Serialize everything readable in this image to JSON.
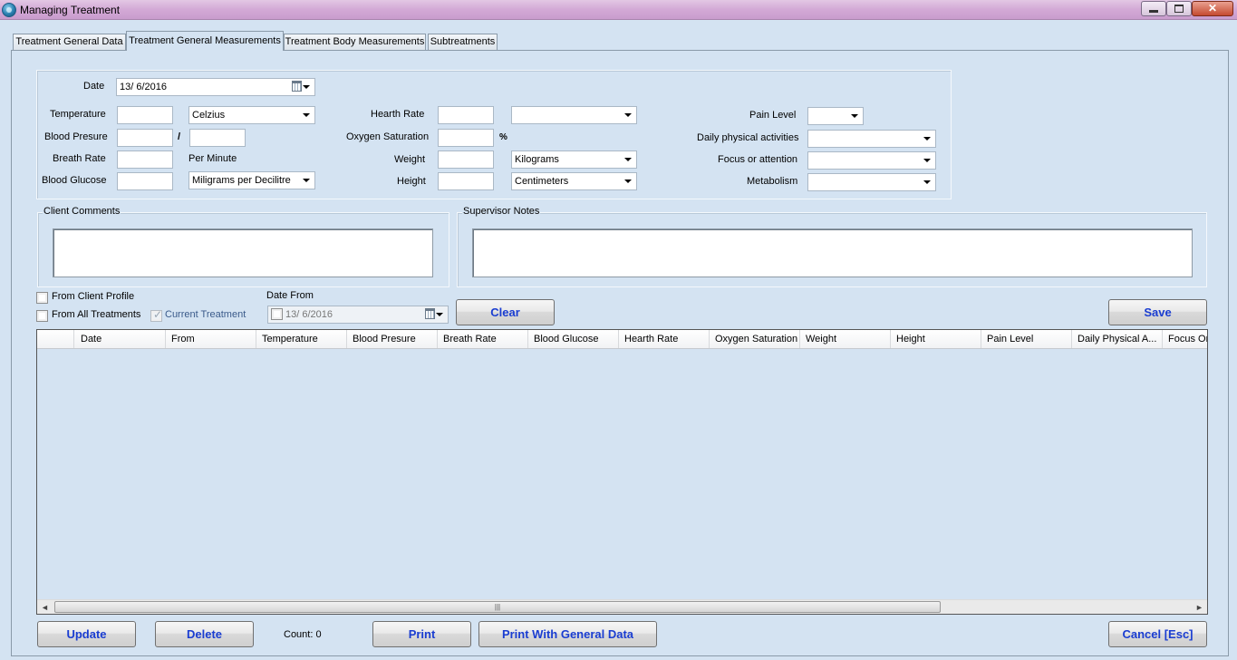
{
  "window": {
    "title": "Managing Treatment",
    "minimize": "",
    "maximize": "",
    "close": "✕"
  },
  "tabs": [
    {
      "label": "Treatment General Data"
    },
    {
      "label": "Treatment General Measurements"
    },
    {
      "label": "Treatment Body Measurements"
    },
    {
      "label": "Subtreatments"
    }
  ],
  "form": {
    "date_label": "Date",
    "date_value": "13/  6/2016",
    "temperature_label": "Temperature",
    "temperature_value": "",
    "temperature_unit": "Celzius",
    "blood_pressure_label": "Blood Presure",
    "blood_pressure_separator": "/",
    "blood_pressure_sys": "",
    "blood_pressure_dia": "",
    "breath_rate_label": "Breath Rate",
    "breath_rate_value": "",
    "breath_rate_unit": "Per Minute",
    "blood_glucose_label": "Blood Glucose",
    "blood_glucose_value": "",
    "blood_glucose_unit": "Miligrams per Decilitre",
    "hearth_rate_label": "Hearth Rate",
    "hearth_rate_value": "",
    "hearth_rate_unit": "",
    "oxygen_label": "Oxygen Saturation",
    "oxygen_value": "",
    "oxygen_unit": "%",
    "weight_label": "Weight",
    "weight_value": "",
    "weight_unit": "Kilograms",
    "height_label": "Height",
    "height_value": "",
    "height_unit": "Centimeters",
    "pain_label": "Pain Level",
    "pain_value": "",
    "daily_label": "Daily physical activities",
    "daily_value": "",
    "focus_label": "Focus or attention",
    "focus_value": "",
    "metabolism_label": "Metabolism",
    "metabolism_value": ""
  },
  "comments": {
    "client_label": "Client Comments",
    "client_value": "",
    "supervisor_label": "Supervisor Notes",
    "supervisor_value": ""
  },
  "filters": {
    "from_client_profile": "From Client Profile",
    "from_all_treatments": "From All Treatments",
    "current_treatment": "Current Treatment",
    "date_from_label": "Date From",
    "date_from_value": "13/  6/2016"
  },
  "buttons": {
    "clear": "Clear",
    "save": "Save",
    "update": "Update",
    "delete": "Delete",
    "print": "Print",
    "print_general": "Print With General Data",
    "cancel": "Cancel [Esc]"
  },
  "grid": {
    "columns": [
      "Date",
      "From",
      "Temperature",
      "Blood Presure",
      "Breath Rate",
      "Blood Glucose",
      "Hearth Rate",
      "Oxygen Saturation",
      "Weight",
      "Height",
      "Pain Level",
      "Daily Physical A...",
      "Focus Or"
    ],
    "scroll_left": "◄",
    "scroll_right": "►",
    "scroll_grip": "|||"
  },
  "count_label": "Count: 0"
}
